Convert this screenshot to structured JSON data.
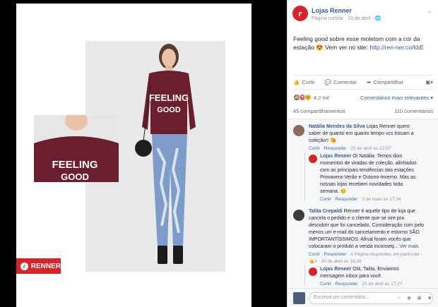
{
  "post": {
    "page_name": "Lojas Renner",
    "meta": "Página curtida · 19 de abril · ",
    "caption_text": "Feeling good sobre esse moletom com a cor da estação 😍 Vem ver no site: ",
    "caption_link": "http://ren-ner.co/kbE",
    "actions": {
      "like": "Curtir",
      "comment": "Comentar",
      "share": "Compartilhar"
    },
    "reactions_count": "4,2 mil",
    "relevance": "Comentários mais relevantes ▾",
    "shares": "45 compartilhamentos",
    "comments_count": "110 comentários"
  },
  "image": {
    "brand_label": "RENNER",
    "sweater_text_1": "FEELING",
    "sweater_text_2": "GOOD"
  },
  "comments": [
    {
      "name": "Natália Mendes da Silva",
      "text": " Lojas Renner quero saber de quanto em quanto tempo vcs trocam a coleção!! 😘",
      "footer_like": "Curtir",
      "footer_reply": "Responder",
      "footer_time": " · 25 de abril às 22:57",
      "reply": {
        "name": "Lojas Renner",
        "text": " Oi Natália. Temos dois momentos de viradas de coleção, alinhados com as principais tendências das estações Primavera-Verão e Outono-Inverno. Mas as nossas lojas recebem novidades toda semana. 😊",
        "footer_like": "Curtir",
        "footer_reply": "Responder",
        "footer_time": " · 3 de maio às 17:34"
      }
    },
    {
      "name": "Talita Crepaldi",
      "text": " Renner é aquele tipo de loja que cancela o pedido e o cliente que se vire pra descobrir que foi cancelado. Consideração com pelo menos um e-mail do cancelamento e estorno SÃO IMPORTANTÍSSIMOS. Afinal foram vocês que colocaram o produto a venda inconseq... ",
      "see_more": "Ver mais",
      "footer_like": "Curtir",
      "footer_reply": "Responder",
      "footer_extra": " · A Página respondeu em particular · ",
      "footer_likes": "3",
      "footer_time": " · 20 de abril às 16:28",
      "reply": {
        "name": "Lojas Renner",
        "text": " Olá, Talita. Enviamos mensagem inbox para você.",
        "footer_like": "Curtir",
        "footer_reply": "Responder",
        "footer_time": " · 20 de abril às 17:27"
      }
    }
  ],
  "composer": {
    "placeholder": "Escreva um comentário...",
    "icons": "☺ ◉ ▣ ☻"
  },
  "colors": {
    "brand": "#d9232b",
    "link": "#365899",
    "sweater": "#6b1f2c",
    "jeans": "#7e9cc9"
  }
}
